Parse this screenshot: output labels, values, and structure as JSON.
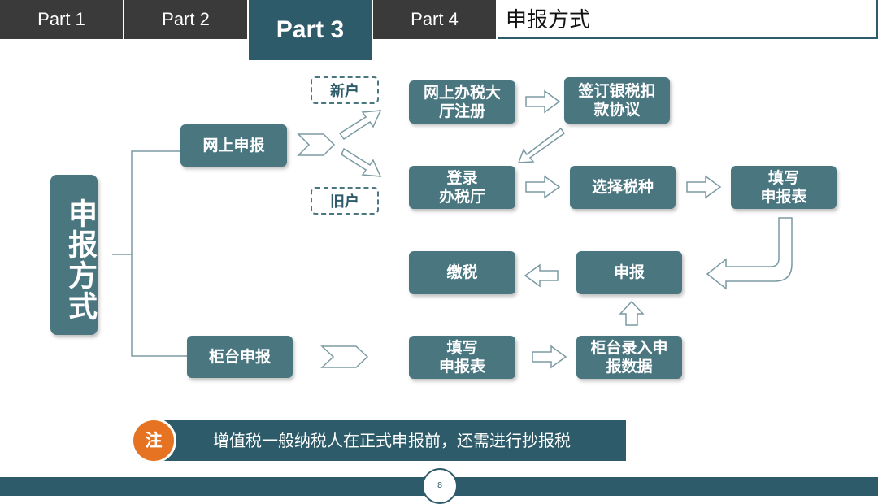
{
  "nav": {
    "tabs": [
      {
        "label": "Part 1"
      },
      {
        "label": "Part 2"
      },
      {
        "label": "Part 3"
      },
      {
        "label": "Part 4"
      }
    ],
    "active_index": 2,
    "section_title": "申报方式"
  },
  "diagram": {
    "root": "申报方式",
    "branches": {
      "online": "网上申报",
      "counter": "柜台申报"
    },
    "tags": {
      "new_user": "新户",
      "old_user": "旧户"
    },
    "nodes": {
      "register": "网上办税大\n厅注册",
      "sign_agreement": "签订银税扣\n款协议",
      "login": "登录\n办税厅",
      "choose_tax": "选择税种",
      "fill_form_online": "填写\n申报表",
      "declare": "申报",
      "pay_tax": "缴税",
      "fill_form_counter": "填写\n申报表",
      "counter_entry": "柜台录入申\n报数据"
    }
  },
  "note": {
    "badge": "注",
    "text": "增值税一般纳税人在正式申报前，还需进行抄报税"
  },
  "footer": {
    "page_number": "8"
  },
  "colors": {
    "box": "#4a7680",
    "accent": "#2d5b69",
    "tab_inactive": "#3a3a3a",
    "note_badge": "#e67321"
  }
}
